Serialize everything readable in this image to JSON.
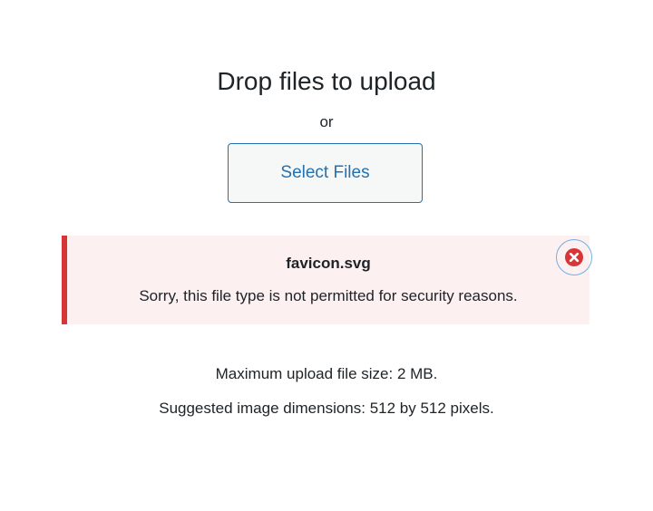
{
  "uploader": {
    "title": "Drop files to upload",
    "or_text": "or",
    "select_button_label": "Select Files"
  },
  "error": {
    "filename": "favicon.svg",
    "message": "Sorry, this file type is not permitted for security reasons.",
    "dismiss_icon": "dismiss-circle-x-icon"
  },
  "info": {
    "max_size": "Maximum upload file size: 2 MB.",
    "suggested_dimensions": "Suggested image dimensions: 512 by 512 pixels."
  },
  "colors": {
    "accent": "#2271b1",
    "error_red": "#d63638",
    "error_bg": "#fcf0f1",
    "focus_ring": "#72aee6",
    "text": "#1d2327"
  }
}
